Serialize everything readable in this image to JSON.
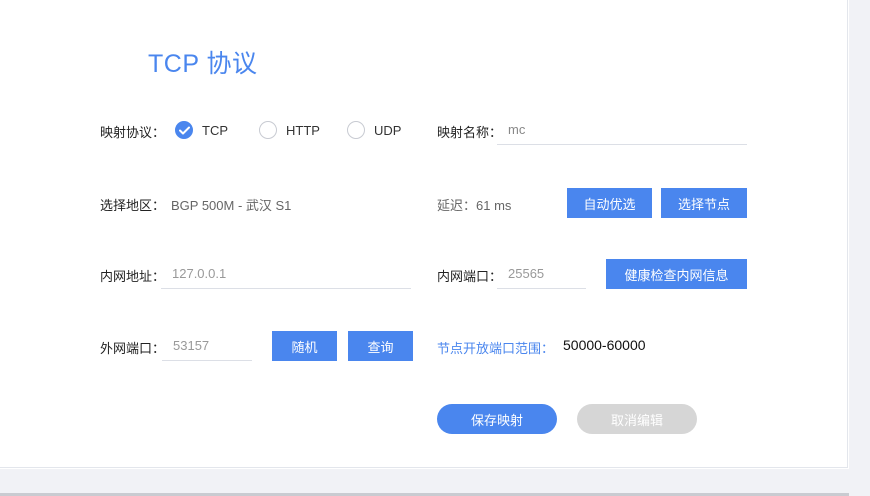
{
  "title": "TCP 协议",
  "protocol": {
    "label": "映射协议：",
    "options": [
      {
        "label": "TCP",
        "checked": true
      },
      {
        "label": "HTTP",
        "checked": false
      },
      {
        "label": "UDP",
        "checked": false
      }
    ]
  },
  "mapping_name": {
    "label": "映射名称：",
    "value": "mc"
  },
  "region": {
    "label": "选择地区：",
    "value": "BGP 500M - 武汉 S1"
  },
  "latency": {
    "text": "延迟：61 ms"
  },
  "buttons": {
    "auto_select": "自动优选",
    "select_node": "选择节点",
    "health_check": "健康检查内网信息",
    "random": "随机",
    "query": "查询",
    "save": "保存映射",
    "cancel": "取消编辑"
  },
  "local_address": {
    "label": "内网地址：",
    "placeholder": "127.0.0.1"
  },
  "local_port": {
    "label": "内网端口：",
    "placeholder": "25565"
  },
  "remote_port": {
    "label": "外网端口：",
    "placeholder": "53157"
  },
  "port_range": {
    "label": "节点开放端口范围：",
    "value": "50000-60000"
  },
  "colors": {
    "accent": "#4a86ee",
    "disabled": "#d6d6d6"
  }
}
